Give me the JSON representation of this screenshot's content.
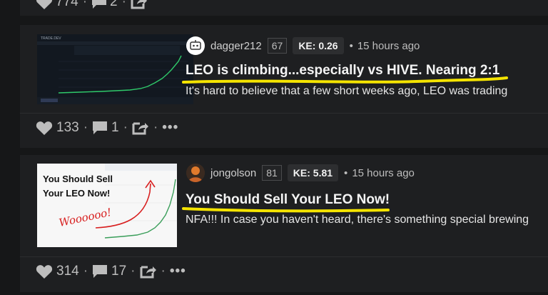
{
  "colors": {
    "background": "#161718",
    "card": "#1e1f21",
    "highlight": "#f5e400",
    "icon": "#bdbdbd"
  },
  "top_card": {
    "votes": "774",
    "comments": "2",
    "more": "•••"
  },
  "posts": [
    {
      "author": "dagger212",
      "reputation": "67",
      "ke": "KE: 0.26",
      "time": "15 hours ago",
      "title": "LEO is climbing...especially vs HIVE. Nearing 2:1",
      "excerpt": "It's hard to believe that a few short weeks ago, LEO was trading",
      "votes": "133",
      "comments": "1",
      "more": "•••",
      "thumbnail": {
        "brand": "TRADE.DEV"
      },
      "avatar_icon": "robot-icon"
    },
    {
      "author": "jongolson",
      "reputation": "81",
      "ke": "KE: 5.81",
      "time": "15 hours ago",
      "title": "You Should Sell Your LEO Now!",
      "excerpt": "NFA!!! In case you haven't heard, there's something special brewing",
      "votes": "314",
      "comments": "17",
      "more": "•••",
      "thumbnail": {
        "line1": "You Should Sell",
        "line2": "Your LEO Now!",
        "scribble": "Woooooo!"
      },
      "avatar_icon": "person-avatar-icon"
    }
  ],
  "icons": {
    "vote": "heart-icon",
    "comment": "comment-icon",
    "share": "share-icon",
    "more": "more-icon"
  }
}
